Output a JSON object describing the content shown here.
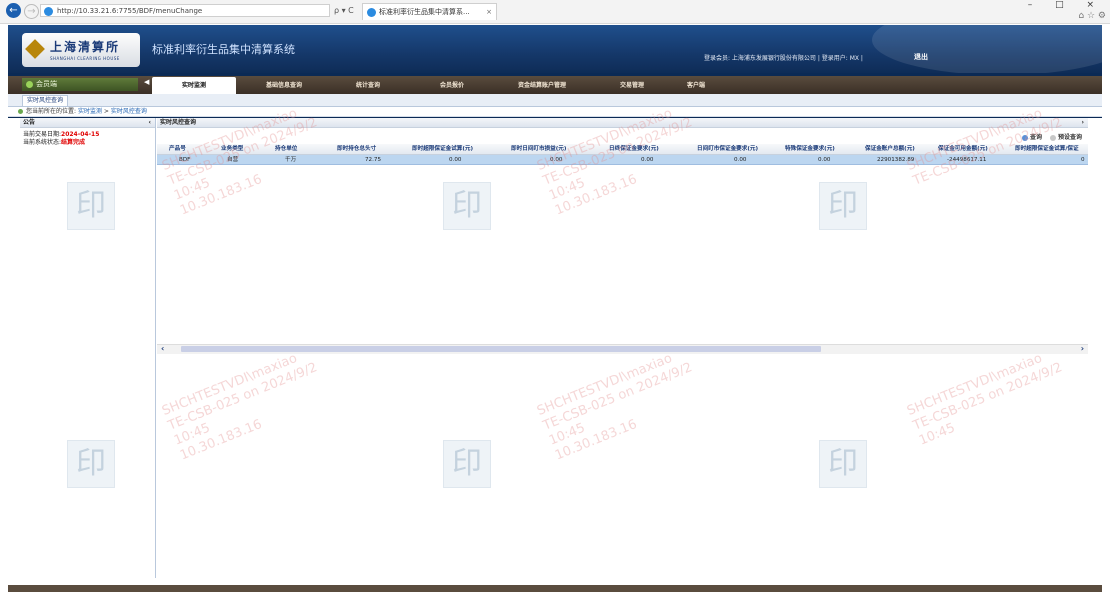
{
  "browser": {
    "url": "http://10.33.21.6:7755/BDF/menuChange",
    "addr_tools": "ρ ▾ C",
    "tab_title": "标准利率衍生品集中清算系...",
    "tab_close": "×",
    "window_controls": "– □ ×",
    "right_tools": "⌂ ☆ ⚙"
  },
  "header": {
    "logo_cn": "上海清算所",
    "logo_en": "SHANGHAI CLEARING HOUSE",
    "system_title": "标准利率衍生品集中清算系统",
    "login_info": "登录会员: 上海浦东发展银行股份有限公司 | 登录用户: MX |",
    "logout": "退出"
  },
  "menu": {
    "member_tab": "会员端",
    "items": [
      {
        "label": "实时监测",
        "active": true
      },
      {
        "label": "基础信息查询",
        "active": false
      },
      {
        "label": "统计查询",
        "active": false
      },
      {
        "label": "会员报价",
        "active": false
      },
      {
        "label": "资金结算账户管理",
        "active": false
      },
      {
        "label": "交易管理",
        "active": false
      },
      {
        "label": "客户端",
        "active": false
      }
    ]
  },
  "subtab": "实时风控查询",
  "breadcrumb": {
    "prefix": "您当前所在的位置:",
    "items": [
      "实时监测",
      "实时风控查询"
    ],
    "sep": ">"
  },
  "notice": {
    "title": "公告",
    "date_label": "当前交易日期:",
    "date_value": "2024-04-15",
    "status_label": "当前系统状态:",
    "status_value": "结算完成"
  },
  "panel": {
    "title": "实时风控查询",
    "query_btn": "查询",
    "preset_query_btn": "预设查询"
  },
  "table": {
    "columns": [
      "产品号",
      "业务类型",
      "持仓单位",
      "即时持仓总头寸",
      "即时超限保证金试算(元)",
      "即时日间盯市损益(元)",
      "日终保证金要求(元)",
      "日间盯市保证金要求(元)",
      "特殊保证金要求(元)",
      "保证金账户总额(元)",
      "保证金可用金额(元)",
      "即时超限保证金试算/保证"
    ],
    "rows": [
      [
        "BDF",
        "自营",
        "千万",
        "72.75",
        "0.00",
        "0.00",
        "0.00",
        "0.00",
        "0.00",
        "22901382.89",
        "-24498617.11",
        "0"
      ]
    ]
  },
  "watermark": {
    "line1": "SHCHTESTVDI\\maxiao",
    "line2": "TE-CSB-025 on 2024/9/2",
    "line3": "10:45",
    "line4": "10.30.183.16",
    "seal": "印"
  }
}
